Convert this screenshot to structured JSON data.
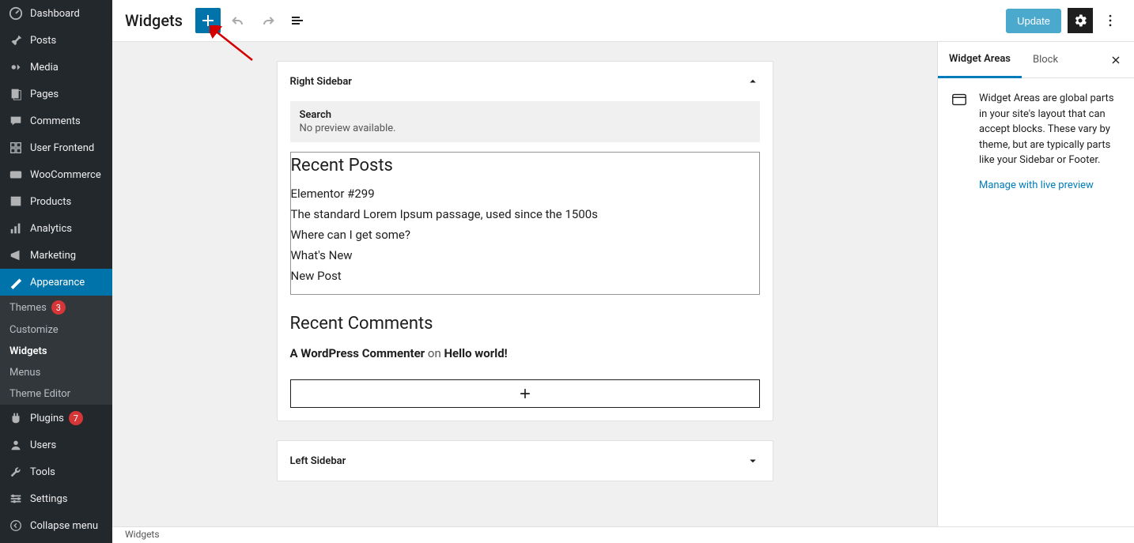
{
  "sidebar": {
    "items": [
      {
        "label": "Dashboard",
        "icon": "dashboard"
      },
      {
        "label": "Posts",
        "icon": "pin"
      },
      {
        "label": "Media",
        "icon": "media"
      },
      {
        "label": "Pages",
        "icon": "pages"
      },
      {
        "label": "Comments",
        "icon": "comments"
      },
      {
        "label": "User Frontend",
        "icon": "userfrontend"
      },
      {
        "label": "WooCommerce",
        "icon": "woo"
      },
      {
        "label": "Products",
        "icon": "products"
      },
      {
        "label": "Analytics",
        "icon": "analytics"
      },
      {
        "label": "Marketing",
        "icon": "marketing"
      },
      {
        "label": "Appearance",
        "icon": "appearance",
        "active": true
      },
      {
        "label": "Plugins",
        "icon": "plugins",
        "badge": "7"
      },
      {
        "label": "Users",
        "icon": "users"
      },
      {
        "label": "Tools",
        "icon": "tools"
      },
      {
        "label": "Settings",
        "icon": "settings"
      },
      {
        "label": "Collapse menu",
        "icon": "collapse"
      }
    ],
    "submenu": [
      {
        "label": "Themes",
        "badge": "3"
      },
      {
        "label": "Customize"
      },
      {
        "label": "Widgets",
        "current": true
      },
      {
        "label": "Menus"
      },
      {
        "label": "Theme Editor"
      }
    ]
  },
  "header": {
    "title": "Widgets",
    "update_label": "Update"
  },
  "areas": {
    "right_sidebar": {
      "title": "Right Sidebar",
      "search": {
        "title": "Search",
        "sub": "No preview available."
      },
      "recent_posts": {
        "title": "Recent Posts",
        "items": [
          "Elementor #299",
          "The standard Lorem Ipsum passage, used since the 1500s",
          "Where can I get some?",
          "What's New",
          "New Post"
        ]
      },
      "recent_comments": {
        "title": "Recent Comments",
        "author": "A WordPress Commenter",
        "on": " on ",
        "post": "Hello world!"
      }
    },
    "left_sidebar": {
      "title": "Left Sidebar"
    }
  },
  "panel": {
    "tabs": {
      "areas": "Widget Areas",
      "block": "Block"
    },
    "desc": "Widget Areas are global parts in your site's layout that can accept blocks. These vary by theme, but are typically parts like your Sidebar or Footer.",
    "link": "Manage with live preview"
  },
  "footer": {
    "breadcrumb": "Widgets"
  }
}
